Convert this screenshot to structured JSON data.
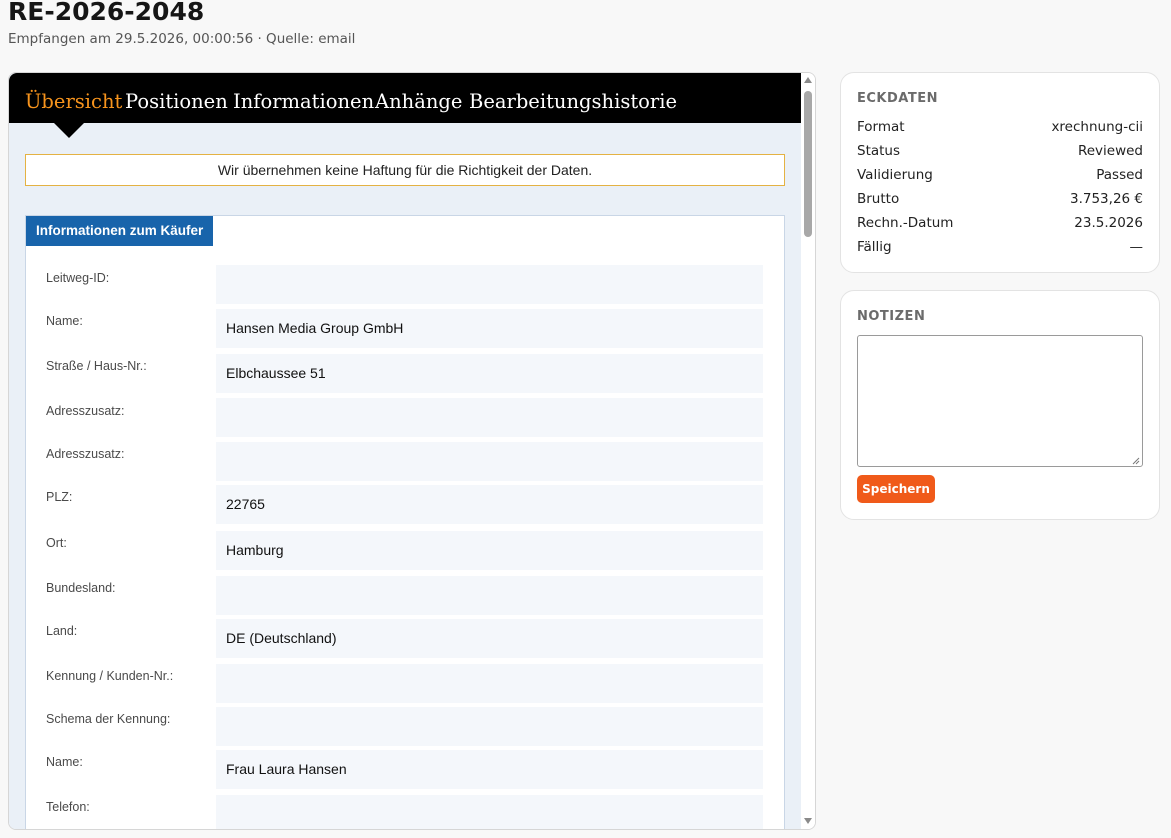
{
  "header": {
    "title": "RE-2026-2048",
    "subtitle": "Empfangen am 29.5.2026, 00:00:56 · Quelle: email"
  },
  "tabs": [
    {
      "label": "Übersicht",
      "active": true
    },
    {
      "label": "Positionen",
      "active": false
    },
    {
      "label": "Informationen",
      "active": false
    },
    {
      "label": "Anhänge",
      "active": false
    },
    {
      "label": "Bearbeitungshistorie",
      "active": false
    }
  ],
  "disclaimer": "Wir übernehmen keine Haftung für die Richtigkeit der Daten.",
  "buyer_section": {
    "title": "Informationen zum Käufer",
    "fields": [
      {
        "label": "Leitweg-ID:",
        "value": ""
      },
      {
        "label": "Name:",
        "value": "Hansen Media Group GmbH"
      },
      {
        "label": "Straße / Haus-Nr.:",
        "value": "Elbchaussee 51"
      },
      {
        "label": "Adresszusatz:",
        "value": ""
      },
      {
        "label": "Adresszusatz:",
        "value": ""
      },
      {
        "label": "PLZ:",
        "value": "22765"
      },
      {
        "label": "Ort:",
        "value": "Hamburg"
      },
      {
        "label": "Bundesland:",
        "value": ""
      },
      {
        "label": "Land:",
        "value": "DE (Deutschland)"
      },
      {
        "label": "Kennung / Kunden-Nr.:",
        "value": ""
      },
      {
        "label": "Schema der Kennung:",
        "value": ""
      },
      {
        "label": "Name:",
        "value": "Frau Laura Hansen"
      },
      {
        "label": "Telefon:",
        "value": ""
      }
    ]
  },
  "eckdaten": {
    "title": "ECKDATEN",
    "rows": [
      {
        "key": "Format",
        "value": "xrechnung-cii"
      },
      {
        "key": "Status",
        "value": "Reviewed"
      },
      {
        "key": "Validierung",
        "value": "Passed"
      },
      {
        "key": "Brutto",
        "value": "3.753,26 €"
      },
      {
        "key": "Rechn.-Datum",
        "value": "23.5.2026"
      },
      {
        "key": "Fällig",
        "value": "—"
      }
    ]
  },
  "notizen": {
    "title": "NOTIZEN",
    "textarea_value": "",
    "save_label": "Speichern"
  },
  "colors": {
    "active_tab": "#f7941d",
    "section_header": "#1864ab",
    "save_button": "#f05a1a",
    "disclaimer_border": "#e4b243"
  }
}
